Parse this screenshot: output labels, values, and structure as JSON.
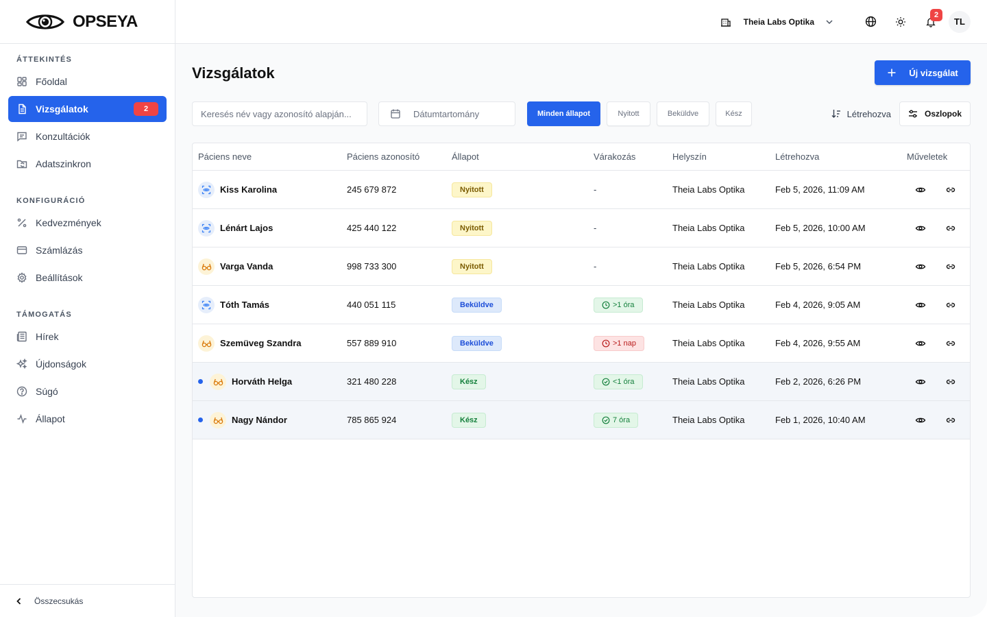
{
  "app": {
    "name": "OPSEYA"
  },
  "sidebar": {
    "sections": [
      {
        "title": "ÁTTEKINTÉS"
      },
      {
        "title": "KONFIGURÁCIÓ"
      },
      {
        "title": "TÁMOGATÁS"
      }
    ],
    "items": [
      {
        "label": "Főoldal",
        "icon": "dashboard-icon"
      },
      {
        "label": "Vizsgálatok",
        "icon": "document-icon",
        "badge": "2",
        "active": true
      },
      {
        "label": "Konzultációk",
        "icon": "chat-icon"
      },
      {
        "label": "Adatszinkron",
        "icon": "folder-sync-icon"
      },
      {
        "label": "Kedvezmények",
        "icon": "percent-icon"
      },
      {
        "label": "Számlázás",
        "icon": "credit-card-icon"
      },
      {
        "label": "Beállítások",
        "icon": "gear-icon"
      },
      {
        "label": "Hírek",
        "icon": "newspaper-icon"
      },
      {
        "label": "Újdonságok",
        "icon": "sparkles-icon"
      },
      {
        "label": "Súgó",
        "icon": "help-icon"
      },
      {
        "label": "Állapot",
        "icon": "activity-icon"
      }
    ],
    "collapse_label": "Összecsukás"
  },
  "topbar": {
    "org_name": "Theia Labs Optika",
    "notification_count": "2",
    "avatar_initials": "TL"
  },
  "page": {
    "title": "Vizsgálatok",
    "new_button": "Új vizsgálat",
    "search_placeholder": "Keresés név vagy azonosító alapján...",
    "date_range_placeholder": "Dátumtartomány",
    "filters": [
      "Minden állapot",
      "Nyitott",
      "Beküldve",
      "Kész"
    ],
    "active_filter": "Minden állapot",
    "sort_label": "Létrehozva",
    "columns_button": "Oszlopok"
  },
  "table": {
    "headers": [
      "Páciens neve",
      "Páciens azonosító",
      "Állapot",
      "Várakozás",
      "Helyszín",
      "Létrehozva",
      "Műveletek"
    ],
    "rows": [
      {
        "name": "Kiss Karolina",
        "type": "scan",
        "id": "245 679 872",
        "status": "Nyitott",
        "status_kind": "open",
        "wait": "-",
        "wait_kind": "none",
        "location": "Theia Labs Optika",
        "created": "Feb 5, 2026, 11:09 AM",
        "unread": false
      },
      {
        "name": "Lénárt Lajos",
        "type": "scan",
        "id": "425 440 122",
        "status": "Nyitott",
        "status_kind": "open",
        "wait": "-",
        "wait_kind": "none",
        "location": "Theia Labs Optika",
        "created": "Feb 5, 2026, 10:00 AM",
        "unread": false
      },
      {
        "name": "Varga Vanda",
        "type": "glasses",
        "id": "998 733 300",
        "status": "Nyitott",
        "status_kind": "open",
        "wait": "-",
        "wait_kind": "none",
        "location": "Theia Labs Optika",
        "created": "Feb 5, 2026, 6:54 PM",
        "unread": false
      },
      {
        "name": "Tóth Tamás",
        "type": "scan",
        "id": "440 051 115",
        "status": "Beküldve",
        "status_kind": "sent",
        "wait": ">1 óra",
        "wait_kind": "green-clock",
        "location": "Theia Labs Optika",
        "created": "Feb 4, 2026, 9:05 AM",
        "unread": false
      },
      {
        "name": "Szemüveg Szandra",
        "type": "glasses",
        "id": "557 889 910",
        "status": "Beküldve",
        "status_kind": "sent",
        "wait": ">1 nap",
        "wait_kind": "red-clock",
        "location": "Theia Labs Optika",
        "created": "Feb 4, 2026, 9:55 AM",
        "unread": false
      },
      {
        "name": "Horváth Helga",
        "type": "glasses",
        "id": "321 480 228",
        "status": "Kész",
        "status_kind": "done",
        "wait": "<1 óra",
        "wait_kind": "green-check",
        "location": "Theia Labs Optika",
        "created": "Feb 2, 2026, 6:26 PM",
        "unread": true
      },
      {
        "name": "Nagy Nándor",
        "type": "glasses",
        "id": "785 865 924",
        "status": "Kész",
        "status_kind": "done",
        "wait": "7 óra",
        "wait_kind": "green-check",
        "location": "Theia Labs Optika",
        "created": "Feb 1, 2026, 10:40 AM",
        "unread": true
      }
    ]
  },
  "colors": {
    "accent": "#2563eb",
    "badge": "#ef4444"
  }
}
